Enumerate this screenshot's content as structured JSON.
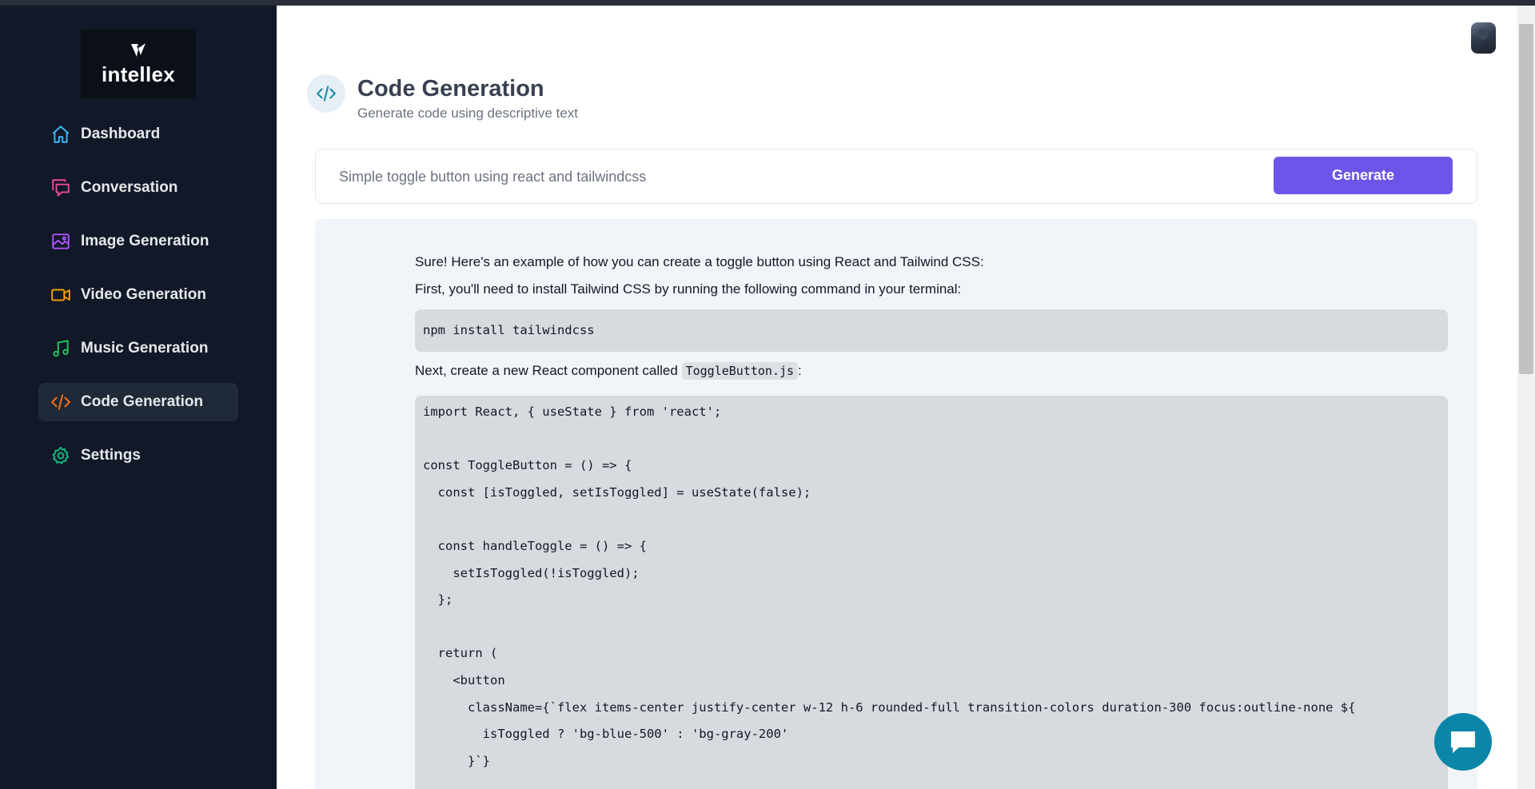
{
  "brand": {
    "name": "intellex"
  },
  "sidebar": {
    "items": [
      {
        "label": "Dashboard",
        "icon": "home-icon",
        "color": "#38bdf8"
      },
      {
        "label": "Conversation",
        "icon": "message-icon",
        "color": "#ec4899"
      },
      {
        "label": "Image Generation",
        "icon": "image-icon",
        "color": "#a855f7"
      },
      {
        "label": "Video Generation",
        "icon": "video-icon",
        "color": "#f59e0b"
      },
      {
        "label": "Music Generation",
        "icon": "music-icon",
        "color": "#22c55e"
      },
      {
        "label": "Code Generation",
        "icon": "code-icon",
        "color": "#f97316",
        "active": true
      },
      {
        "label": "Settings",
        "icon": "settings-icon",
        "color": "#10b981"
      }
    ]
  },
  "header": {
    "title": "Code Generation",
    "subtitle": "Generate code using descriptive text",
    "icon": "code-icon"
  },
  "form": {
    "prompt_value": "Simple toggle button using react and tailwindcss",
    "generate_label": "Generate",
    "button_color": "#6c56e9"
  },
  "response": {
    "intro": "Sure! Here's an example of how you can create a toggle button using React and Tailwind CSS:",
    "install_text": "First, you'll need to install Tailwind CSS by running the following command in your terminal:",
    "install_command": "npm install tailwindcss",
    "component_text_before": "Next, create a new React component called ",
    "component_filename": "ToggleButton.js",
    "component_text_after": ":",
    "code": "import React, { useState } from 'react';\n\nconst ToggleButton = () => {\n  const [isToggled, setIsToggled] = useState(false);\n\n  const handleToggle = () => {\n    setIsToggled(!isToggled);\n  };\n\n  return (\n    <button\n      className={`flex items-center justify-center w-12 h-6 rounded-full transition-colors duration-300 focus:outline-none ${\n        isToggled ? 'bg-blue-500' : 'bg-gray-200'\n      }`}"
  },
  "user": {
    "avatar": "user-avatar"
  },
  "chat": {
    "icon": "chat-icon",
    "color": "#0b86a9"
  }
}
